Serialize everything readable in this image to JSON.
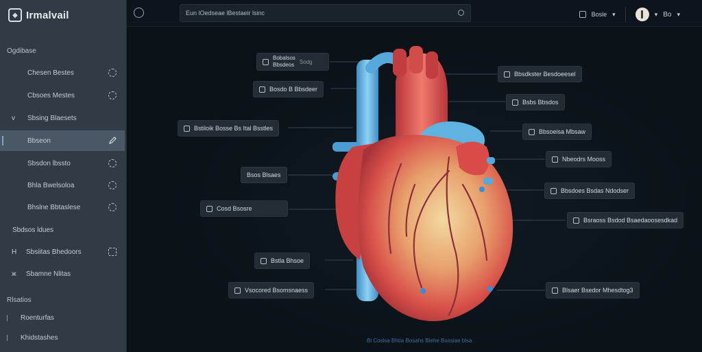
{
  "app": {
    "logo_text": "Irmalvail"
  },
  "sidebar": {
    "section_1": "Ogdibase",
    "items": [
      {
        "label": "Chesen Bestes"
      },
      {
        "label": "Cbsoes Mestes"
      },
      {
        "label": "Sbsing Blaesets",
        "lead": "v"
      },
      {
        "label": "Bbseon",
        "active": true
      },
      {
        "label": "Sbsdon lbssto"
      },
      {
        "label": "Bhla Bwelsoloa"
      },
      {
        "label": "Bhslne Bbtaslese"
      }
    ],
    "sub_items": [
      {
        "label": "Sbdsos ldues"
      },
      {
        "label": "Sbsiitas Bhedoors",
        "lead": "H"
      },
      {
        "label": "Sbamne Nlitas",
        "lead": "ж"
      }
    ],
    "section_2": "Rlsatios",
    "bottom_items": [
      {
        "label": "Roenturfas"
      },
      {
        "label": "Khidstashes"
      }
    ]
  },
  "topbar": {
    "search_text": "Eun lOedseae lBestaeir lsinc",
    "user_menu": "Bosle",
    "counter": "Bo"
  },
  "labels": [
    {
      "text": "Bobalsos\nBbsdeos",
      "suffix": "Sodg"
    },
    {
      "text": "Bosdo B Bbsdeer"
    },
    {
      "text": "Bstiloik Bosse Bs Ital Bsstles"
    },
    {
      "text": "Bsos Blsaes"
    },
    {
      "text": "Cosd Bsosre"
    },
    {
      "text": "Bstla Bhsoe"
    },
    {
      "text": "Vsocored Bsomsnaess"
    },
    {
      "text": "Bbsdkster Besdoeesel"
    },
    {
      "text": "Bsbs Bbsdos"
    },
    {
      "text": "Bbsoeisa Mbsaw"
    },
    {
      "text": "Nbeodrs Mooss"
    },
    {
      "text": "Bbsdoes Bsdas Ndodser"
    },
    {
      "text": "Bsraoss Bsdod Bsaedaoosesdkad"
    },
    {
      "text": "Blsaer Bsedor Mhesdtog3"
    }
  ],
  "caption": "Bl Coslsa Bhtia Bosahs Blehe Bsosiae blsa"
}
